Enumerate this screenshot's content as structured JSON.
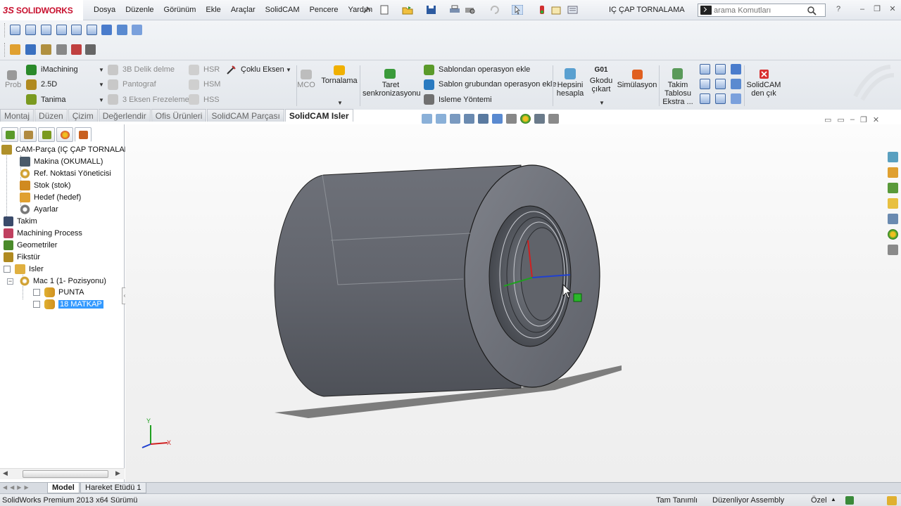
{
  "app": {
    "brand": "SOLIDWORKS",
    "document_title": "IÇ ÇAP TORNALAMA"
  },
  "menu": [
    "Dosya",
    "Düzenle",
    "Görünüm",
    "Ekle",
    "Araçlar",
    "SolidCAM",
    "Pencere",
    "Yardım"
  ],
  "search": {
    "placeholder": "arama Komutları"
  },
  "ribbon": {
    "prob": "Prob",
    "imachining": "iMachining",
    "d25": "2.5D",
    "tanima": "Tanima",
    "delik3b": "3B Delik delme",
    "pantograf": "Pantograf",
    "eksen3": "3 Eksen Frezeleme",
    "hsr": "HSR",
    "hsm": "HSM",
    "hss": "HSS",
    "coklu": "Çoklu Eksen",
    "mco": "MCO",
    "tornalama": "Tornalama",
    "taret_1": "Taret",
    "taret_2": "senkronizasyonu",
    "sablondan": "Sablondan operasyon ekle",
    "sablon_grup": "Sablon grubundan operasyon ekle",
    "isleme": "Isleme Yöntemi",
    "hepsini_1": "Hepsini",
    "hepsini_2": "hesapla",
    "gcode_1": "G01",
    "gcode_2": "Gkodu",
    "gcode_3": "çıkart",
    "simulasyon": "Simülasyon",
    "takim_1": "Takim",
    "takim_2": "Tablosu",
    "takim_3": "Ekstra ...",
    "solidcam_1": "SolidCAM",
    "solidcam_2": "den çık"
  },
  "tabs": [
    "Montaj",
    "Düzen",
    "Çizim",
    "Değerlendir",
    "Ofis Ürünleri",
    "SolidCAM Parçası",
    "SolidCAM Isler"
  ],
  "active_tab": "SolidCAM Isler",
  "tree": {
    "root": "CAM-Parça (IÇ ÇAP TORNALAMA",
    "makina": "Makina (OKUMALL)",
    "ref": "Ref. Noktasi Yöneticisi",
    "stok": "Stok (stok)",
    "hedef": "Hedef (hedef)",
    "ayarlar": "Ayarlar",
    "takim": "Takim",
    "machining": "Machining Process",
    "geometriler": "Geometriler",
    "fikstur": "Fikstür",
    "isler": "Isler",
    "mac": "Mac 1 (1- Pozisyonu)",
    "punta": "PUNTA",
    "matkap": "18 MATKAP"
  },
  "triad": {
    "x": "X",
    "y": "Y"
  },
  "bottom_tabs": [
    "Model",
    "Hareket Etüdü 1"
  ],
  "status": {
    "version": "SolidWorks Premium 2013 x64 Sürümü",
    "defined": "Tam Tanımlı",
    "editing": "Düzenliyor Assembly",
    "units": "Özel"
  },
  "colors": {
    "accent_red": "#c8102e",
    "selection": "#3399ff",
    "part": "#6b6e77"
  }
}
